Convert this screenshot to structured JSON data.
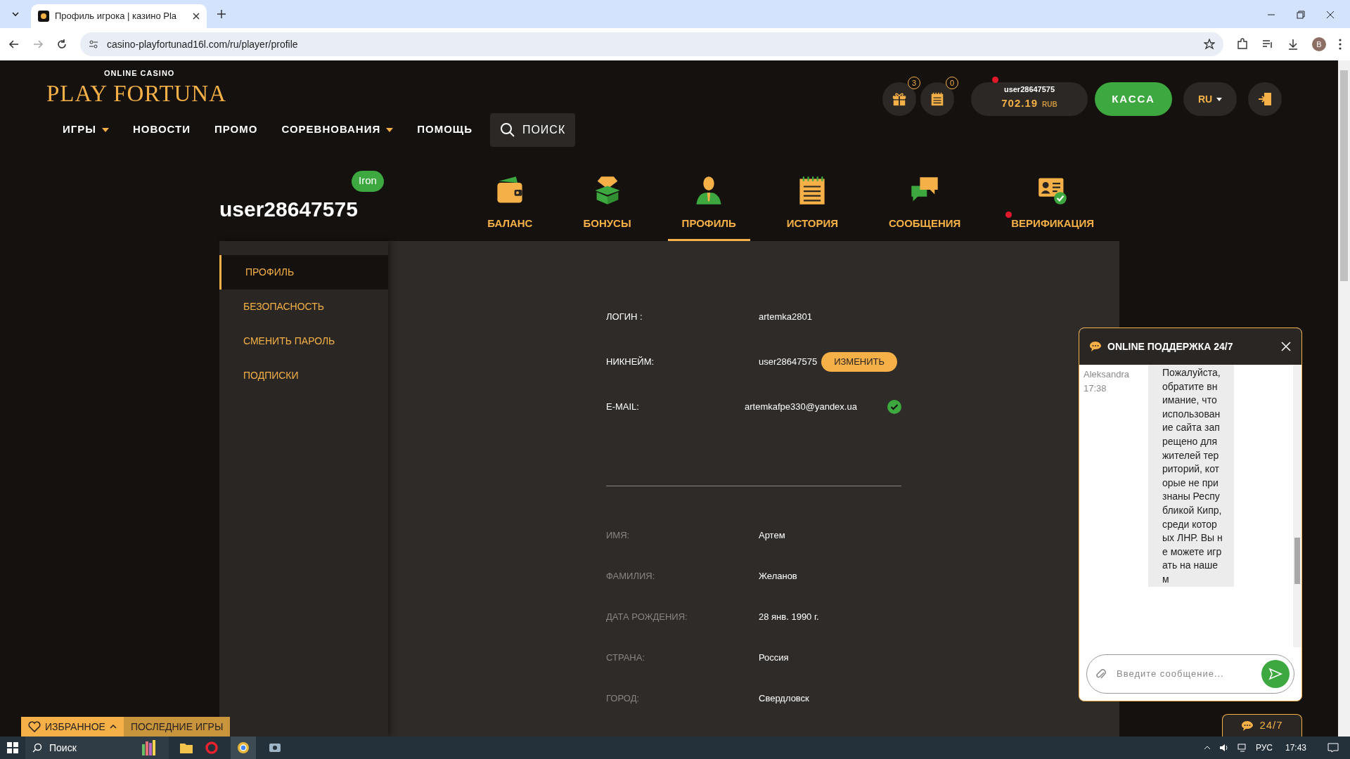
{
  "browser": {
    "tab_title": "Профиль игрока | казино Pla",
    "url": "casino-playfortunad16l.com/ru/player/profile",
    "profile_initial": "B"
  },
  "header": {
    "logo_tagline": "ONLINE CASINO",
    "logo_text": "PLAY FORTUNA",
    "nav": [
      {
        "label": "ИГРЫ",
        "has_dropdown": true
      },
      {
        "label": "НОВОСТИ",
        "has_dropdown": false
      },
      {
        "label": "ПРОМО",
        "has_dropdown": false
      },
      {
        "label": "СОРЕВНОВАНИЯ",
        "has_dropdown": true
      },
      {
        "label": "ПОМОЩЬ",
        "has_dropdown": false
      }
    ],
    "search_label": "ПОИСК",
    "counters": [
      {
        "kind": "gift",
        "count": "3"
      },
      {
        "kind": "calendar",
        "count": "0"
      }
    ],
    "account": {
      "username": "user28647575",
      "alert": true,
      "amount": "702.19",
      "currency": "RUB"
    },
    "cashier_button": "КАССА",
    "language": "RU"
  },
  "profile": {
    "username": "user28647575",
    "level_badge": "Iron",
    "tabs": [
      {
        "kind": "wallet",
        "label": "БАЛАНС",
        "selected": false,
        "alert": false
      },
      {
        "kind": "gift",
        "label": "БОНУСЫ",
        "selected": false,
        "alert": false
      },
      {
        "kind": "person",
        "label": "ПРОФИЛЬ",
        "selected": true,
        "alert": false
      },
      {
        "kind": "notepad",
        "label": "ИСТОРИЯ",
        "selected": false,
        "alert": false
      },
      {
        "kind": "chat",
        "label": "СООБЩЕНИЯ",
        "selected": false,
        "alert": false
      },
      {
        "kind": "id",
        "label": "ВЕРИФИКАЦИЯ",
        "selected": false,
        "alert": true
      }
    ],
    "sidebar": [
      {
        "label": "ПРОФИЛЬ",
        "selected": true
      },
      {
        "label": "БЕЗОПАСНОСТЬ",
        "selected": false
      },
      {
        "label": "СМЕНИТЬ ПАРОЛЬ",
        "selected": false
      },
      {
        "label": "ПОДПИСКИ",
        "selected": false
      }
    ],
    "account_fields": [
      {
        "label": "ЛОГИН :",
        "value": "artemka2801"
      },
      {
        "label": "НИКНЕЙМ:",
        "value": "user28647575",
        "action": "ИЗМЕНИТЬ"
      },
      {
        "label": "E-MAIL:",
        "value": "artemkafpe330@yandex.ua",
        "verified": true
      }
    ],
    "personal_fields": [
      {
        "label": "ИМЯ:",
        "value": "Артем"
      },
      {
        "label": "ФАМИЛИЯ:",
        "value": "Желанов"
      },
      {
        "label": "ДАТА РОЖДЕНИЯ:",
        "value": "28 янв. 1990 г."
      },
      {
        "label": "СТРАНА:",
        "value": "Россия"
      },
      {
        "label": "ГОРОД:",
        "value": "Свердловск"
      }
    ]
  },
  "chat": {
    "title": "ONLINE ПОДДЕРЖКА 24/7",
    "messages": [
      {
        "author": "Aleksandra",
        "time": "17:38",
        "text": "Пожалуйста, обратите внимание, что использование сайта запрещено для жителей территорий, которые не признаны Республикой Кипр, среди которых ЛНР. Вы не можете играть на нашем"
      }
    ],
    "input_placeholder": "Введите сообщение...",
    "launcher_label": "24/7"
  },
  "games_bar": {
    "favorites": "ИЗБРАННОЕ",
    "recent": "ПОСЛЕДНИЕ ИГРЫ"
  },
  "taskbar": {
    "search_placeholder": "Поиск",
    "language": "РУС",
    "time": "17:43"
  }
}
